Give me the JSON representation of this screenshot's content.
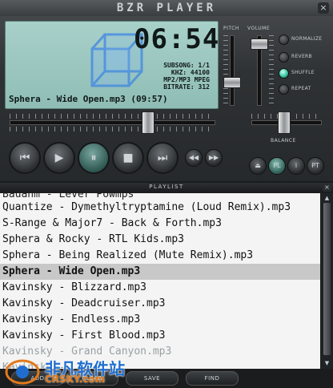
{
  "app": {
    "title": "BZR PLAYER",
    "close": "×"
  },
  "display": {
    "time": "06:54",
    "subsong": "SUBSONG: 1/1",
    "khz": "KHZ: 44100",
    "format": "MP2/MP3 MPEG",
    "bitrate": "BITRATE: 312",
    "now_playing": "Sphera - Wide Open.mp3 (09:57)"
  },
  "sliders": {
    "pitch_label": "PITCH",
    "volume_label": "VOLUME",
    "balance_label": "BALANCE"
  },
  "options": [
    "NORMALIZE",
    "REVERB",
    "SHUFFLE",
    "REPEAT"
  ],
  "options_state": {
    "NORMALIZE": false,
    "REVERB": false,
    "SHUFFLE": true,
    "REPEAT": false
  },
  "transport": {
    "prev": "⏮",
    "play": "▶",
    "pause": "⏸",
    "stop": "■",
    "next": "⏭",
    "rew": "◀◀",
    "ff": "▶▶"
  },
  "extra_buttons": {
    "eject": "⏏",
    "pl": "PL",
    "info": "i",
    "pt": "PT"
  },
  "playlist": {
    "title": "PLAYLIST",
    "close": "×",
    "items": [
      "Bauahm - Lever Powmps",
      "Quantize - Dymethyltryptamine (Loud Remix).mp3",
      "S-Range & Major7 - Back & Forth.mp3",
      "Sphera & Rocky - RTL Kids.mp3",
      "Sphera - Being Realized (Mute Remix).mp3",
      "Sphera - Wide Open.mp3",
      "Kavinsky - Blizzard.mp3",
      "Kavinsky - Deadcruiser.mp3",
      "Kavinsky - Endless.mp3",
      "Kavinsky - First Blood.mp3",
      "Kavinsky - Grand Canyon.mp3",
      "Kavinsky - ..."
    ],
    "selected_index": 5
  },
  "bottom_buttons": [
    "ADD",
    "CLEAR",
    "SAVE",
    "FIND"
  ],
  "watermark": {
    "text": "非凡软件站",
    "sub": "CRSKY.com"
  },
  "colors": {
    "lcd": "#9cc7c0",
    "led_on": "#36c4a0",
    "selection": "#c8c8c8"
  }
}
